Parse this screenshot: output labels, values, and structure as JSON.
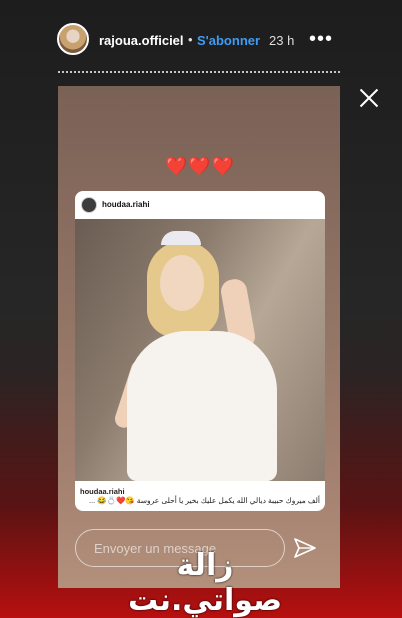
{
  "header": {
    "username": "rajoua.officiel",
    "separator": "•",
    "follow_label": "S'abonner",
    "age": "23 h",
    "more_icon": "more-horizontal-icon"
  },
  "story": {
    "hearts": "❤️❤️❤️",
    "post": {
      "username": "houdaa.riahi",
      "caption_user": "houdaa.riahi",
      "caption_text": "ألف ميروك حبيبة ديالي الله يكمل عليك بخير يا أحلى عروسة 😘❤️💍😂 ..."
    },
    "message_placeholder": "Envoyer un message"
  },
  "watermark": "زالة صواتي.نت"
}
